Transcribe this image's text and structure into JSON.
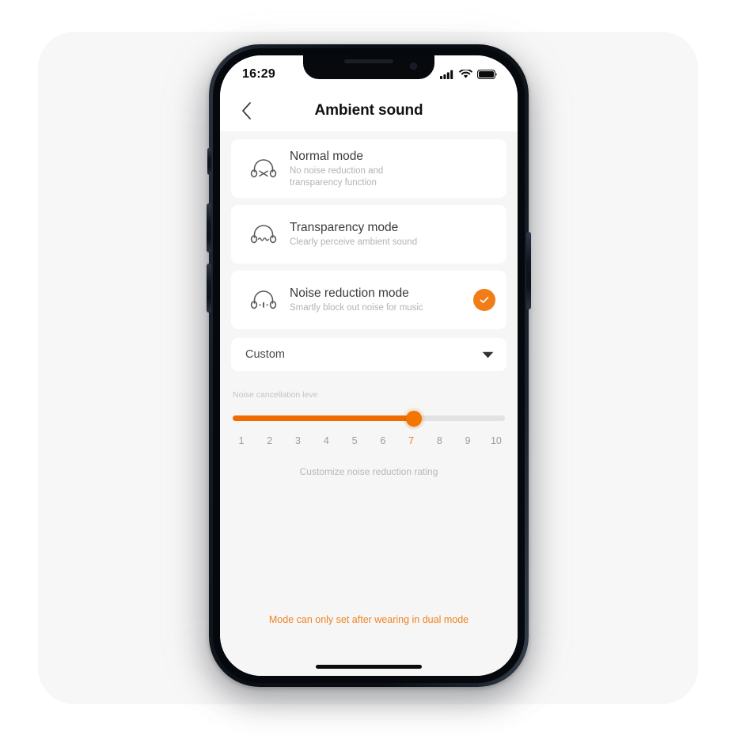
{
  "status_bar": {
    "time": "16:29",
    "icons": [
      "signal-bars-icon",
      "wifi-icon",
      "battery-icon"
    ]
  },
  "header": {
    "title": "Ambient sound",
    "back_icon": "chevron-left-icon"
  },
  "modes": [
    {
      "title": "Normal mode",
      "subtitle_line1": "No noise reduction and",
      "subtitle_line2": "transparency function",
      "icon": "headphone-off-icon",
      "selected": false
    },
    {
      "title": "Transparency mode",
      "subtitle_line1": "Clearly perceive ambient sound",
      "subtitle_line2": "",
      "icon": "headphone-transparency-icon",
      "selected": false
    },
    {
      "title": "Noise reduction mode",
      "subtitle_line1": "Smartly block out noise for music",
      "subtitle_line2": "",
      "icon": "headphone-noise-reduction-icon",
      "selected": true
    }
  ],
  "dropdown": {
    "value": "Custom",
    "icon": "chevron-down-icon"
  },
  "slider": {
    "label": "Noise cancellation leve",
    "value": 7,
    "min": 1,
    "max": 10,
    "ticks": [
      "1",
      "2",
      "3",
      "4",
      "5",
      "6",
      "7",
      "8",
      "9",
      "10"
    ],
    "hint": "Customize noise reduction rating"
  },
  "footer": {
    "note": "Mode can only set after wearing in dual mode"
  },
  "colors": {
    "accent": "#f07d18",
    "slider_fill": "#f06c00",
    "footer_text": "#ef8322",
    "screen_bg": "#f6f6f6",
    "card_bg": "#ffffff"
  }
}
